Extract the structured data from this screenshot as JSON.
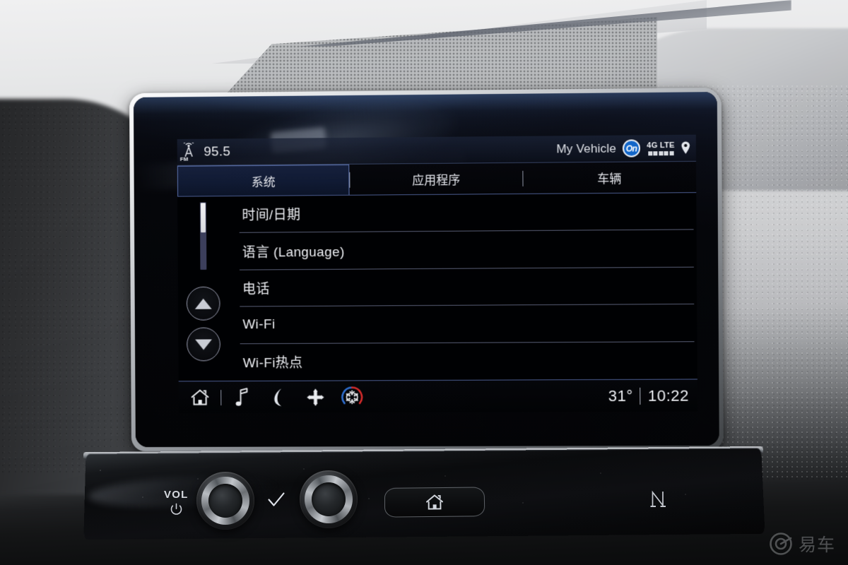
{
  "status_bar": {
    "radio_band": "FM",
    "radio_frequency": "95.5",
    "radio_icon": "broadcast-antenna-icon",
    "vehicle_label": "My Vehicle",
    "onstar_logo_text": "On",
    "network_label": "4G LTE",
    "signal_bars": 5,
    "location_icon": "location-pin-icon"
  },
  "tabs": [
    {
      "label": "系统",
      "active": true
    },
    {
      "label": "应用程序",
      "active": false
    },
    {
      "label": "车辆",
      "active": false
    }
  ],
  "settings_list": [
    {
      "label": "时间/日期"
    },
    {
      "label": "语言 (Language)"
    },
    {
      "label": "电话"
    },
    {
      "label": "Wi-Fi"
    },
    {
      "label": "Wi-Fi热点"
    }
  ],
  "scroll_controls": {
    "up_icon": "triangle-up-icon",
    "down_icon": "triangle-down-icon",
    "scrollbar_position_percent": 0
  },
  "bottom_bar": {
    "buttons": [
      {
        "icon": "home-icon"
      },
      {
        "icon": "music-note-icon"
      },
      {
        "icon": "phone-icon"
      },
      {
        "icon": "navigation-arrows-icon"
      },
      {
        "icon": "climate-snowflake-icon"
      }
    ],
    "temperature": "31°",
    "clock": "10:22"
  },
  "hardware_controls": {
    "volume_label": "VOL",
    "power_icon": "power-icon",
    "left_knob": "volume-knob",
    "checkmark_icon": "checkmark-icon",
    "right_knob": "tune-knob",
    "home_key_icon": "home-icon",
    "nfc_icon": "nfc-icon"
  },
  "watermark": {
    "text": "易车",
    "icon": "yiche-ring-logo"
  },
  "colors": {
    "accent_blue": "#5c72ae",
    "onstar_blue": "#1266c9",
    "tab_active_bg": "#16203c",
    "screen_bg": "#000103",
    "text_primary": "#eceef2",
    "climate_cold": "#2f6fd0",
    "climate_hot": "#d42b2b"
  }
}
